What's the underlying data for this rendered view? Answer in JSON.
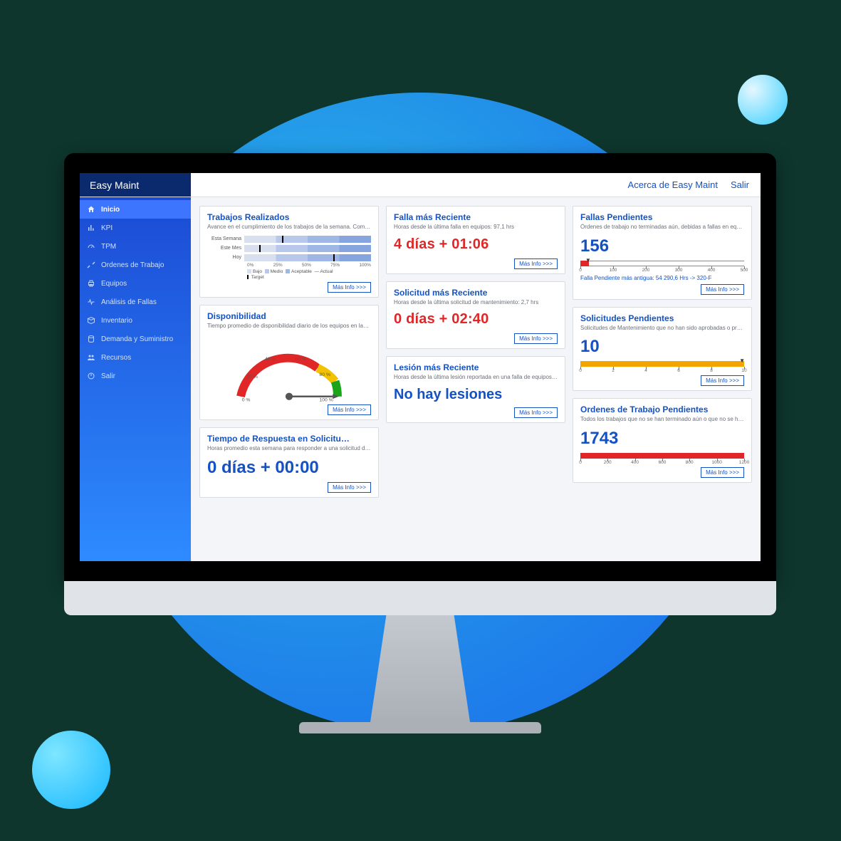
{
  "brand": "Easy Maint",
  "header": {
    "about": "Acerca de Easy Maint",
    "logout": "Salir"
  },
  "sidebar": {
    "items": [
      {
        "id": "inicio",
        "label": "Inicio",
        "icon": "home-icon",
        "active": true
      },
      {
        "id": "kpi",
        "label": "KPI",
        "icon": "chart-icon",
        "active": false
      },
      {
        "id": "tpm",
        "label": "TPM",
        "icon": "gauge-icon",
        "active": false
      },
      {
        "id": "ordenes",
        "label": "Ordenes de Trabajo",
        "icon": "tools-icon",
        "active": false
      },
      {
        "id": "equipos",
        "label": "Equipos",
        "icon": "printer-icon",
        "active": false
      },
      {
        "id": "analisis",
        "label": "Análisis de Fallas",
        "icon": "pulse-icon",
        "active": false
      },
      {
        "id": "inventario",
        "label": "Inventario",
        "icon": "box-icon",
        "active": false
      },
      {
        "id": "demanda",
        "label": "Demanda y Suministro",
        "icon": "db-icon",
        "active": false
      },
      {
        "id": "recursos",
        "label": "Recursos",
        "icon": "people-icon",
        "active": false
      },
      {
        "id": "salir",
        "label": "Salir",
        "icon": "power-icon",
        "active": false
      }
    ]
  },
  "common": {
    "more_info": "Más Info >>>"
  },
  "cards": {
    "trabajos": {
      "title": "Trabajos Realizados",
      "sub": "Avance en el cumplimiento de los trabajos de la semana. Com…",
      "legend": {
        "bajo": "Bajo",
        "medio": "Medio",
        "aceptable": "Aceptable",
        "actual": "Actual",
        "target": "Target"
      }
    },
    "disponibilidad": {
      "title": "Disponibilidad",
      "sub": "Tiempo promedio de disponibilidad diario de los equipos en la…"
    },
    "tiempo_respuesta": {
      "title": "Tiempo de Respuesta en Solicitu…",
      "sub": "Horas promedio esta semana para responder a una solicitud d…",
      "value": "0 días + 00:00"
    },
    "falla_reciente": {
      "title": "Falla más Reciente",
      "sub": "Horas desde la última falla en equipos: 97,1 hrs",
      "value": "4 días + 01:06"
    },
    "solicitud_reciente": {
      "title": "Solicitud más Reciente",
      "sub": "Horas desde la última solicitud de mantenimiento: 2,7 hrs",
      "value": "0 días + 02:40"
    },
    "lesion_reciente": {
      "title": "Lesión más Reciente",
      "sub": "Horas desde la última lesión reportada en una falla de equipos…",
      "value": "No hay lesiones"
    },
    "fallas_pendientes": {
      "title": "Fallas Pendientes",
      "sub": "Órdenes de trabajo no terminadas aún, debidas a fallas en eq…",
      "value": "156",
      "note": "Falla Pendiente más antigua: 54 290,6 Hrs -> 320-F"
    },
    "solicitudes_pendientes": {
      "title": "Solicitudes Pendientes",
      "sub": "Solicitudes de Mantenimiento que no han sido aprobadas o pr…",
      "value": "10"
    },
    "ordenes_pendientes": {
      "title": "Ordenes de Trabajo Pendientes",
      "sub": "Todos los trabajos que no se han terminado aún o que no se h…",
      "value": "1743"
    }
  },
  "chart_data": {
    "trabajos_realizados": {
      "type": "bar",
      "orientation": "horizontal",
      "categories": [
        "Esta Semana",
        "Este Mes",
        "Hoy"
      ],
      "values": [
        30,
        12,
        70
      ],
      "xlim": [
        0,
        100
      ],
      "x_ticks": [
        "0%",
        "25%",
        "50%",
        "75%",
        "100%"
      ],
      "bands": [
        {
          "name": "Bajo",
          "range": [
            0,
            25
          ]
        },
        {
          "name": "Medio",
          "range": [
            25,
            50
          ]
        },
        {
          "name": "Aceptable",
          "range": [
            50,
            75
          ]
        },
        {
          "name": "Actual",
          "range": [
            75,
            100
          ]
        }
      ],
      "target_line": true
    },
    "disponibilidad_gauge": {
      "type": "gauge",
      "value": 100,
      "range": [
        0,
        100
      ],
      "tick_labels": [
        "0 %",
        "20 %",
        "40 %",
        "60 %",
        "80 %",
        "100 %"
      ],
      "zones": [
        {
          "color": "#e02626",
          "from": 0,
          "to": 70
        },
        {
          "color": "#f2c200",
          "from": 70,
          "to": 90
        },
        {
          "color": "#1aa41a",
          "from": 90,
          "to": 100
        }
      ]
    },
    "fallas_pendientes_scale": {
      "type": "scale",
      "value": 156,
      "fill_to": 5,
      "range": [
        0,
        500
      ],
      "ticks": [
        0,
        100,
        200,
        300,
        400,
        500
      ],
      "color": "#e02626"
    },
    "solicitudes_pendientes_scale": {
      "type": "scale",
      "value": 10,
      "fill_to": 100,
      "range": [
        0,
        10
      ],
      "ticks": [
        0,
        2,
        4,
        6,
        8,
        10
      ],
      "color": "#f2a500"
    },
    "ordenes_pendientes_scale": {
      "type": "scale",
      "value": 1743,
      "fill_to": 100,
      "range": [
        0,
        1200
      ],
      "ticks": [
        0,
        200,
        400,
        600,
        800,
        1000,
        1200
      ],
      "color": "#e02626"
    }
  }
}
